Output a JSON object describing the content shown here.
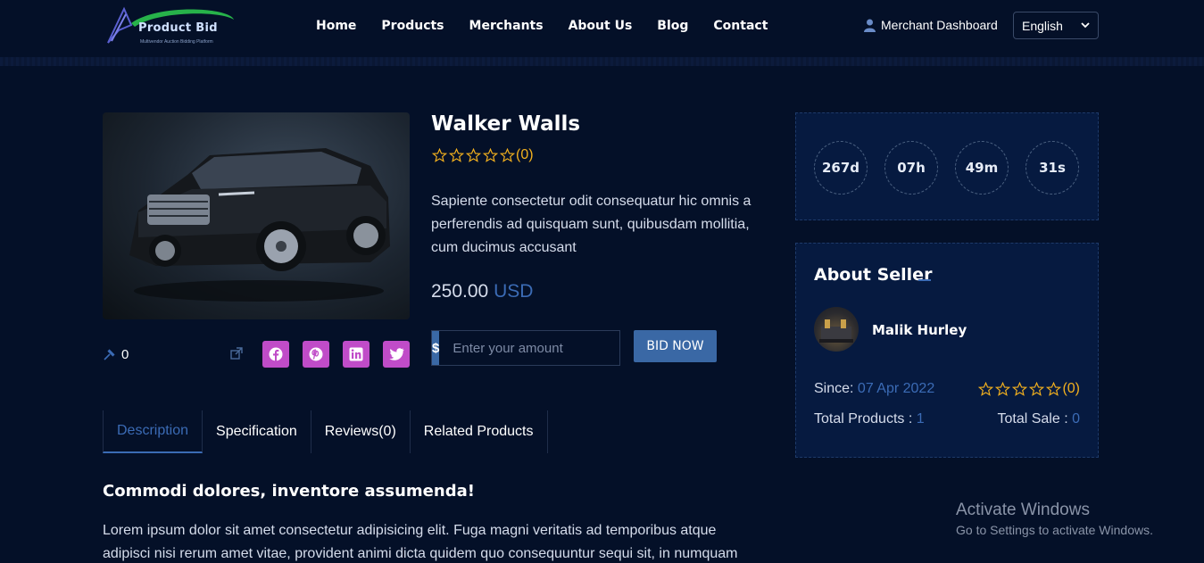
{
  "logo": {
    "title": "Product Bid",
    "subtitle": "Multivendor Auction Bidding Platform"
  },
  "nav": [
    "Home",
    "Products",
    "Merchants",
    "About Us",
    "Blog",
    "Contact"
  ],
  "header": {
    "merchant_dashboard": "Merchant Dashboard",
    "language": "English"
  },
  "product": {
    "title": "Walker Walls",
    "rating_count": "(0)",
    "description": "Sapiente consectetur odit consequatur hic omnis a perferendis ad quisquam sunt, quibusdam mollitia, cum ducimus accusant",
    "price": "250.00",
    "currency": "USD",
    "bid_count": "0",
    "stars": 0
  },
  "bid": {
    "prefix": "$",
    "placeholder": "Enter your amount",
    "button": "BID NOW"
  },
  "social": [
    {
      "name": "facebook-icon",
      "color": "#c04cc8"
    },
    {
      "name": "pinterest-icon",
      "color": "#c04cc8"
    },
    {
      "name": "linkedin-icon",
      "color": "#c04cc8"
    },
    {
      "name": "twitter-icon",
      "color": "#c04cc8"
    }
  ],
  "tabs": [
    "Description",
    "Specification",
    "Reviews(0)",
    "Related Products"
  ],
  "tab_content": {
    "heading": "Commodi dolores, inventore assumenda!",
    "body": "Lorem ipsum dolor sit amet consectetur adipisicing elit. Fuga magni veritatis ad temporibus atque adipisci nisi rerum amet vitae, provident animi dicta quidem quo consequuntur sequi sit, in numquam"
  },
  "countdown": [
    "267d",
    "07h",
    "49m",
    "31s"
  ],
  "seller": {
    "title": "About Seller",
    "name": "Malik Hurley",
    "since_label": "Since:",
    "since_value": "07 Apr 2022",
    "rating_count": "(0)",
    "total_products_label": "Total Products :",
    "total_products_value": "1",
    "total_sale_label": "Total Sale :",
    "total_sale_value": "0"
  },
  "watermark": {
    "title": "Activate Windows",
    "subtitle": "Go to Settings to activate Windows."
  },
  "colors": {
    "background": "#041028",
    "accent": "#3a68a5",
    "star": "#f2b01e",
    "social": "#c04cc8"
  }
}
